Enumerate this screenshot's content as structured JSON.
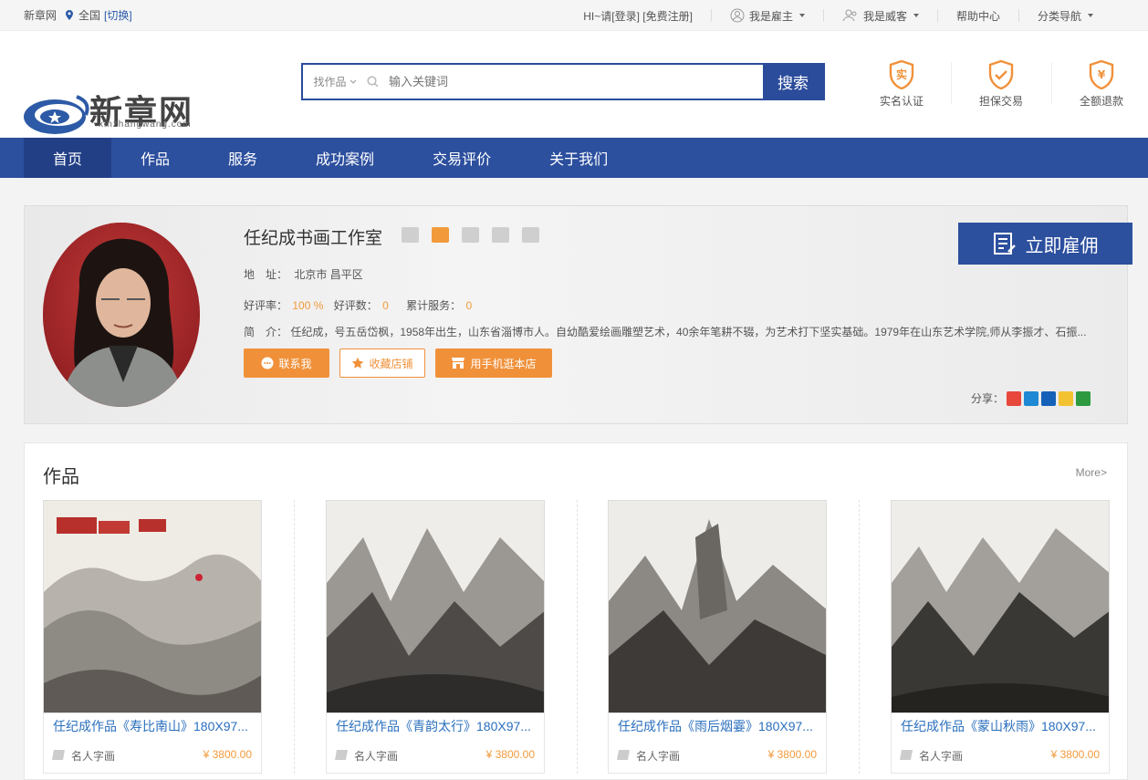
{
  "topbar": {
    "site": "新章网",
    "region": "全国",
    "switch": "[切换]",
    "greeting": "HI~请[登录] [免费注册]",
    "employer": "我是雇主",
    "provider": "我是威客",
    "help": "帮助中心",
    "category": "分类导航"
  },
  "logo": {
    "text": "新章网",
    "sub": "xinzhangwang.com"
  },
  "search": {
    "scope": "找作品",
    "placeholder": "输入关键词",
    "button": "搜索"
  },
  "guarantees": [
    {
      "label": "实名认证",
      "glyph": "实"
    },
    {
      "label": "担保交易",
      "glyph": "✓"
    },
    {
      "label": "全额退款",
      "glyph": "¥"
    }
  ],
  "nav": [
    "首页",
    "作品",
    "服务",
    "成功案例",
    "交易评价",
    "关于我们"
  ],
  "shop": {
    "name": "任纪成书画工作室",
    "address_label": "地　址：",
    "address": "北京市 昌平区",
    "rate_label": "好评率：",
    "rate": "100 %",
    "good_label": "好评数：",
    "good": "0",
    "service_label": "累计服务：",
    "service": "0",
    "intro_label": "简　介：",
    "intro": "任纪成，号五岳岱枫，1958年出生，山东省淄博市人。自幼酷爱绘画雕塑艺术，40余年笔耕不辍，为艺术打下坚实基础。1979年在山东艺术学院,师从李振才、石振...",
    "contact": "联系我",
    "favorite": "收藏店铺",
    "mobile": "用手机逛本店",
    "hire": "立即雇佣",
    "share": "分享："
  },
  "works": {
    "title": "作品",
    "more": "More>",
    "items": [
      {
        "name": "任纪成作品《寿比南山》180X97...",
        "tag": "名人字画",
        "price": "¥ 3800.00"
      },
      {
        "name": "任纪成作品《青韵太行》180X97...",
        "tag": "名人字画",
        "price": "¥ 3800.00"
      },
      {
        "name": "任纪成作品《雨后烟霎》180X97...",
        "tag": "名人字画",
        "price": "¥ 3800.00"
      },
      {
        "name": "任纪成作品《蒙山秋雨》180X97...",
        "tag": "名人字画",
        "price": "¥ 3800.00"
      }
    ]
  },
  "colors": {
    "primary": "#2c4f9e",
    "accent": "#f0913a",
    "link": "#2a6fbd"
  }
}
